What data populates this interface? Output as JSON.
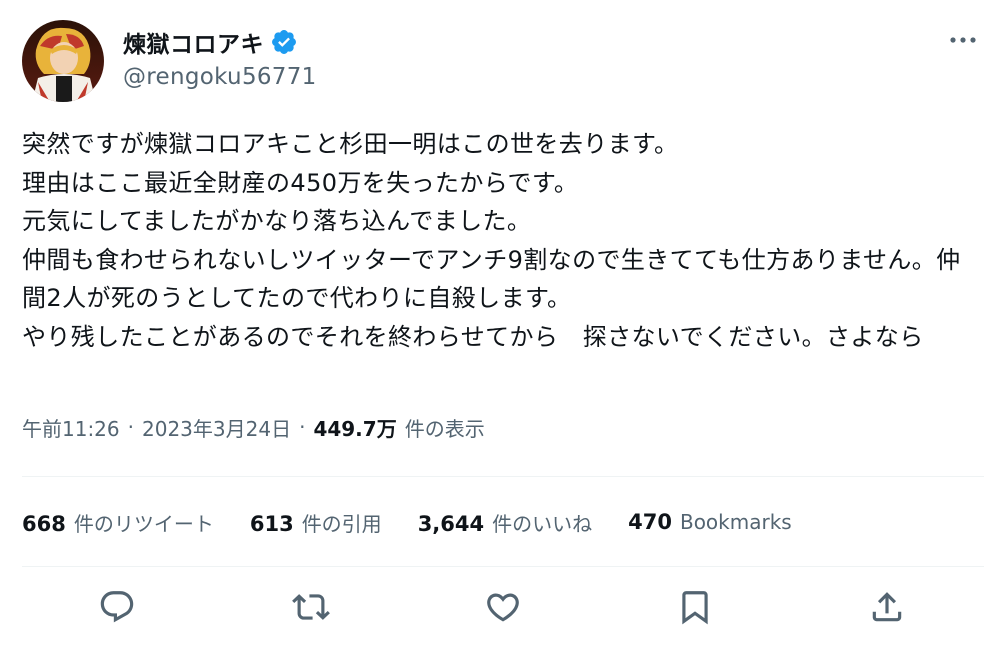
{
  "author": {
    "display_name": "煉獄コロアキ",
    "handle": "@rengoku56771",
    "avatar_icon": "avatar",
    "verified_icon": "verified-badge-icon",
    "verified_color": "#1d9bf0"
  },
  "tweet": {
    "text": "突然ですが煉獄コロアキこと杉田一明はこの世を去ります。\n理由はここ最近全財産の450万を失ったからです。\n元気にしてましたがかなり落ち込んでました。\n仲間も食わせられないしツイッターでアンチ9割なので生きてても仕方ありません。仲間2人が死のうとしてたので代わりに自殺します。\nやり残したことがあるのでそれを終わらせてから　探さないでください。さよなら"
  },
  "meta": {
    "time": "午前11:26",
    "separator": "·",
    "date": "2023年3月24日",
    "views_count": "449.7万",
    "views_label": "件の表示"
  },
  "stats": {
    "retweets_count": "668",
    "retweets_label": "件のリツイート",
    "quotes_count": "613",
    "quotes_label": "件の引用",
    "likes_count": "3,644",
    "likes_label": "件のいいね",
    "bookmarks_count": "470",
    "bookmarks_label": "Bookmarks"
  },
  "colors": {
    "text_primary": "#0f1419",
    "text_secondary": "#536471",
    "divider": "#eff3f4",
    "accent": "#1d9bf0"
  },
  "icons": {
    "more": "more-icon",
    "reply": "reply-icon",
    "retweet": "retweet-icon",
    "like": "heart-icon",
    "bookmark": "bookmark-icon",
    "share": "share-icon"
  }
}
